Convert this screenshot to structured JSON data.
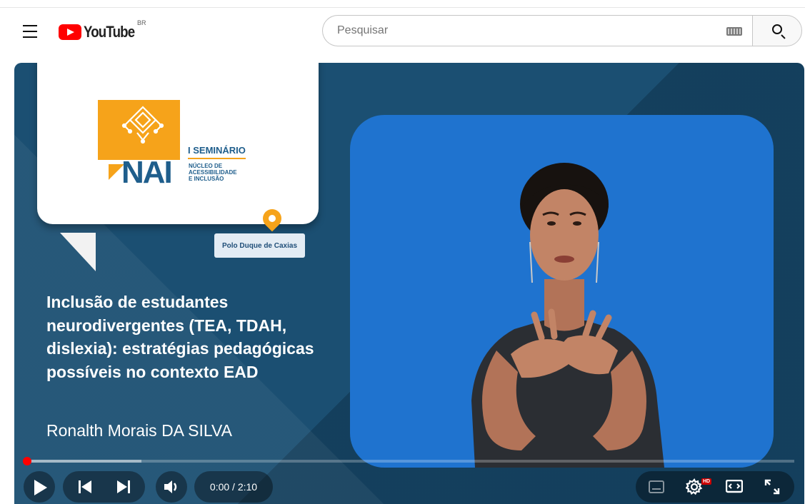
{
  "header": {
    "menu_icon": "hamburger-menu-icon",
    "logo_text": "YouTube",
    "region": "BR",
    "search_placeholder": "Pesquisar",
    "search_value": "",
    "keyboard_icon": "keyboard-icon",
    "search_icon": "search-icon"
  },
  "video": {
    "seminar_label": "I SEMINÁRIO",
    "org_abbr": "NAI",
    "org_name_lines": [
      "NÚCLEO DE",
      "ACESSIBILIDADE",
      "E INCLUSÃO"
    ],
    "location_badge": "Polo Duque de Caxias",
    "title": "Inclusão de estudantes neurodivergentes (TEA, TDAH, dislexia): estratégias pedagógicas possíveis no contexto EAD",
    "author": "Ronalth Morais DA SILVA"
  },
  "player": {
    "current_time": "0:00",
    "duration": "2:10",
    "time_display": "0:00 / 2:10",
    "played_fraction": 0.0,
    "buffered_fraction": 0.15,
    "hd_badge": "HD",
    "icons": [
      "play-icon",
      "previous-icon",
      "next-icon",
      "volume-icon",
      "subtitles-icon",
      "settings-icon",
      "theater-mode-icon",
      "fullscreen-icon"
    ]
  },
  "colors": {
    "youtube_red": "#ff0000",
    "video_blue": "#1b4f72",
    "nai_orange": "#f6a31a",
    "nai_blue": "#1f5e8c",
    "interpreter_bg": "#1f73cf"
  }
}
